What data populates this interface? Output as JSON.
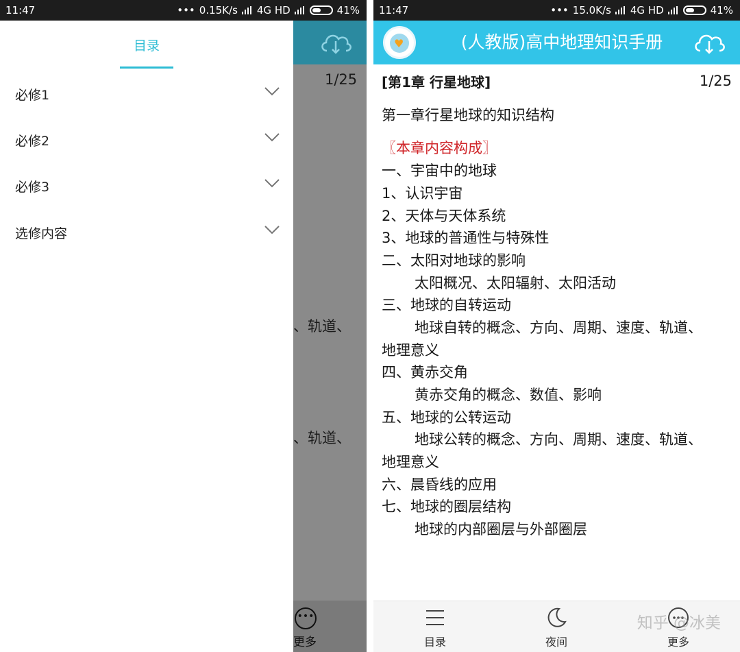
{
  "left_screen": {
    "status": {
      "time": "11:47",
      "dots": "•••",
      "speed": "0.15K/s",
      "network": "4G HD",
      "battery": "41%"
    },
    "behind": {
      "page": "1/25",
      "partial_lines": [
        "、轨道、",
        "、轨道、"
      ],
      "more_label": "更多"
    },
    "drawer": {
      "title": "目录",
      "items": [
        {
          "label": "必修1"
        },
        {
          "label": "必修2"
        },
        {
          "label": "必修3"
        },
        {
          "label": "选修内容"
        }
      ]
    }
  },
  "right_screen": {
    "status": {
      "time": "11:47",
      "dots": "•••",
      "speed": "15.0K/s",
      "network": "4G HD",
      "battery": "41%"
    },
    "header": {
      "title": "(人教版)高中地理知识手册"
    },
    "content": {
      "chapter": "[第1章 行星地球]",
      "page": "1/25",
      "lines": [
        {
          "text": "第一章行星地球的知识结构"
        },
        {
          "text": "〖本章内容构成〗"
        },
        {
          "text": "一、宇宙中的地球"
        },
        {
          "text": "1、认识宇宙"
        },
        {
          "text": "2、天体与天体系统"
        },
        {
          "text": "3、地球的普通性与特殊性"
        },
        {
          "text": "二、太阳对地球的影响"
        },
        {
          "text": "太阳概况、太阳辐射、太阳活动"
        },
        {
          "text": "三、地球的自转运动"
        },
        {
          "text": "地球自转的概念、方向、周期、速度、轨道、"
        },
        {
          "text": "地理意义"
        },
        {
          "text": "四、黄赤交角"
        },
        {
          "text": "黄赤交角的概念、数值、影响"
        },
        {
          "text": "五、地球的公转运动"
        },
        {
          "text": "地球公转的概念、方向、周期、速度、轨道、"
        },
        {
          "text": "地理意义"
        },
        {
          "text": "六、晨昏线的应用"
        },
        {
          "text": "七、地球的圈层结构"
        },
        {
          "text": "地球的内部圈层与外部圈层"
        }
      ]
    },
    "nav": {
      "toc": "目录",
      "night": "夜间",
      "more": "更多"
    }
  },
  "watermark": "知乎 @冰美",
  "colors": {
    "accent": "#2cbcd4",
    "header": "#32c4e8",
    "highlight_red": "#d0262a"
  },
  "icons": [
    "cloud-download-icon",
    "chevron-down-icon",
    "menu-icon",
    "moon-icon",
    "more-icon",
    "app-logo-icon"
  ]
}
